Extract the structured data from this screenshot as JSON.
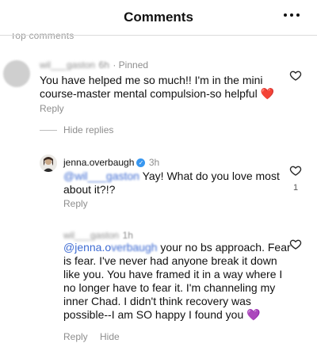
{
  "header": {
    "title": "Comments"
  },
  "section_label": "Top comments",
  "comments": [
    {
      "username": "wil___gaston",
      "time": "6h",
      "pinned": "Pinned",
      "text": "You have helped me so much!! I'm in the mini course-master mental compulsion-so helpful ❤️",
      "reply": "Reply"
    }
  ],
  "hide_replies": "Hide replies",
  "replies": [
    {
      "username": "jenna.overbaugh",
      "time": "3h",
      "mention": "@wil___gaston",
      "text": " Yay! What do you love most about it?!?",
      "reply": "Reply",
      "likes": "1"
    },
    {
      "username": "wil___gaston",
      "time": "1h",
      "mention_prefix": "@jenna.o",
      "mention_suffix": "verbaugh",
      "text": " your no bs approach. Fear is fear. I've never had anyone break it down like you. You have framed it in a way where I no longer have to fear it. I'm channeling my inner Chad. I didn't think recovery was possible--I am SO happy I found you 💜",
      "reply": "Reply",
      "hide": "Hide"
    }
  ],
  "icons": {
    "more": "more-horizontal-icon",
    "like": "heart-outline-icon",
    "verified": "verified-badge-icon"
  }
}
